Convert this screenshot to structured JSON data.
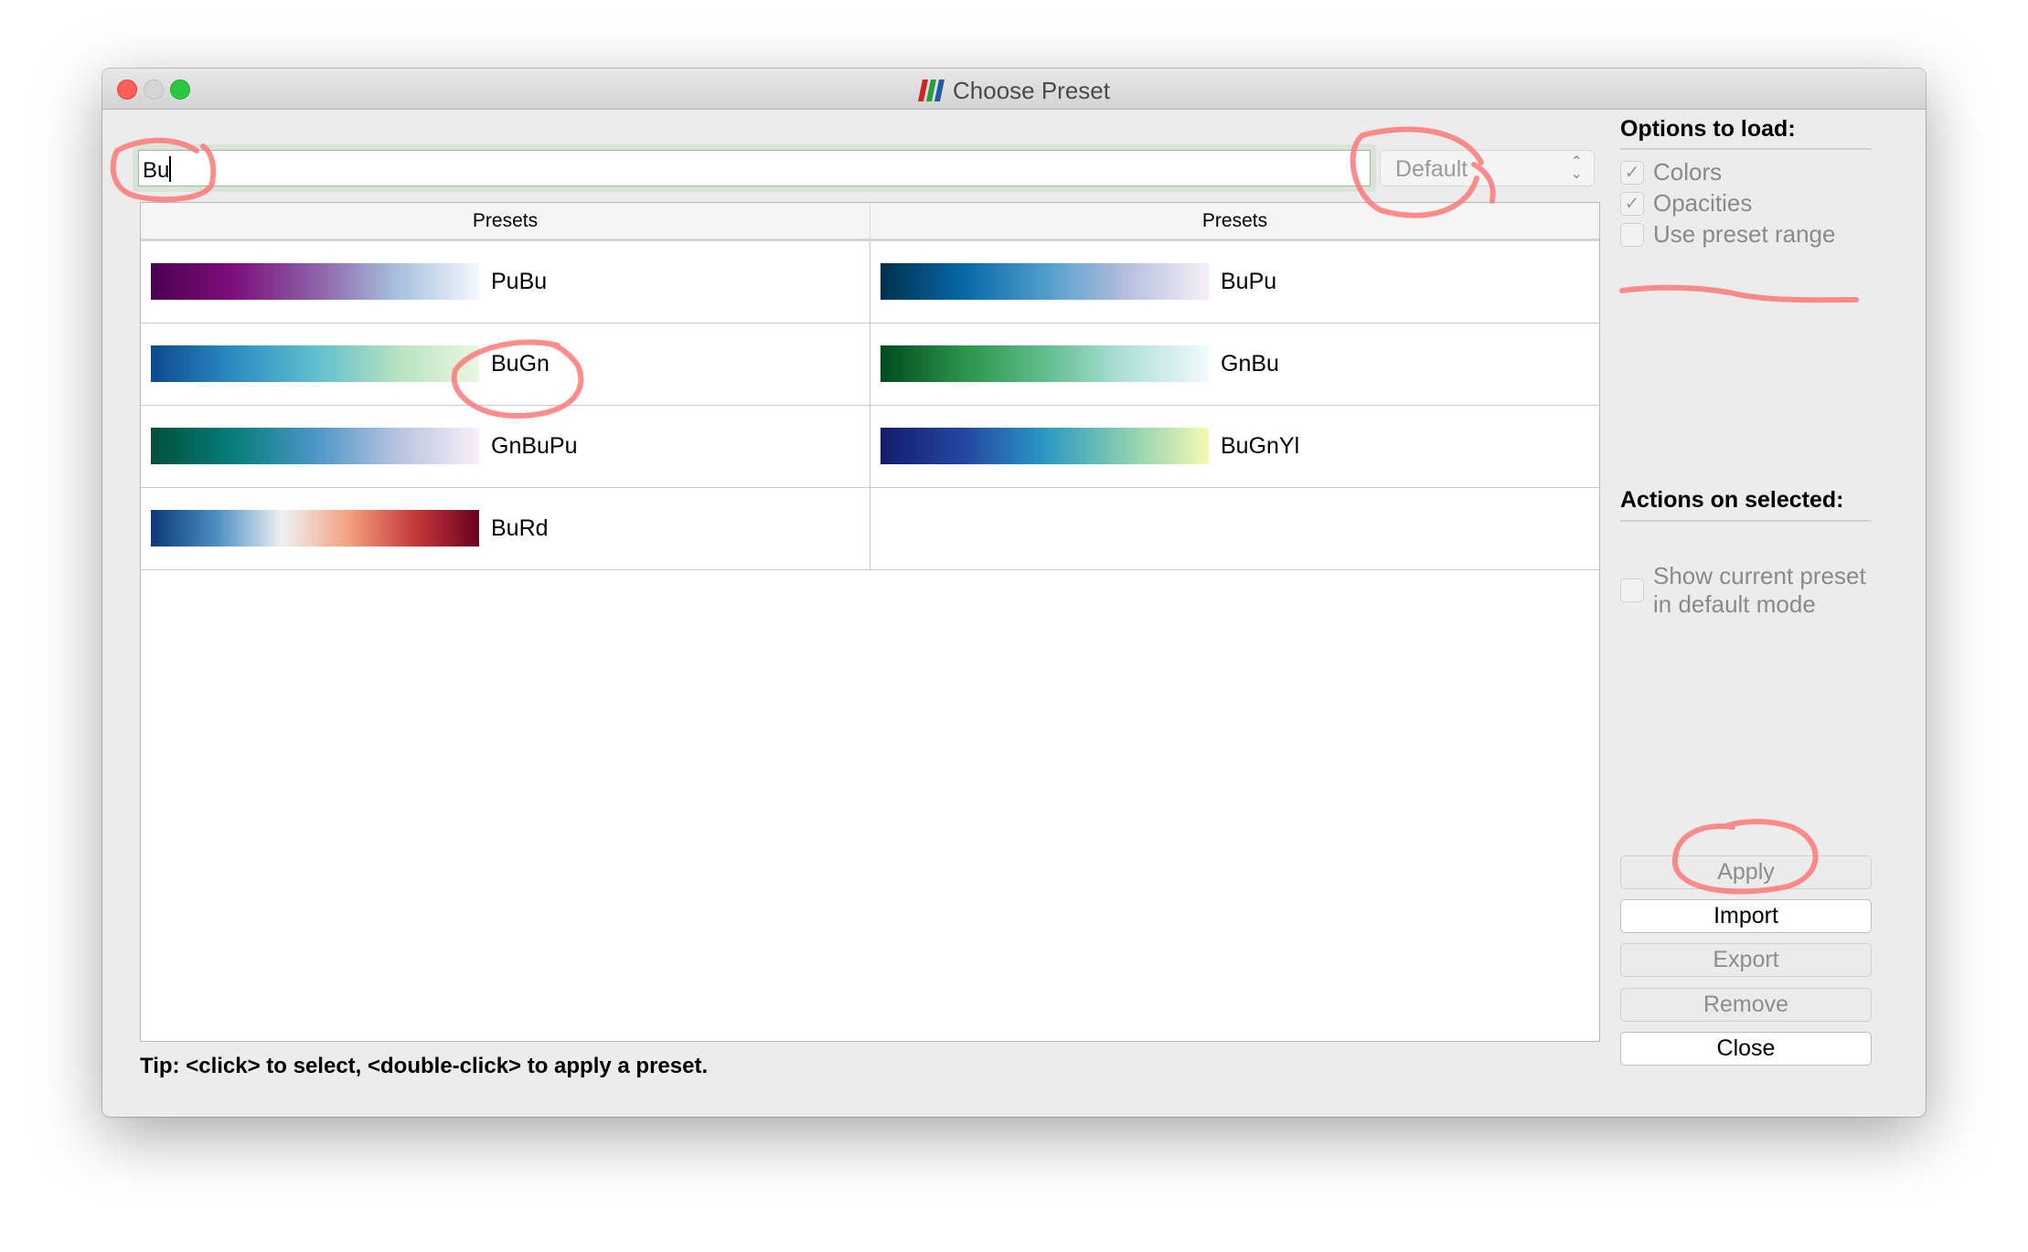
{
  "window": {
    "title": "Choose Preset",
    "logo": "paraview-logo-icon"
  },
  "search": {
    "value": "Bu"
  },
  "mode_select": {
    "value": "Default"
  },
  "table": {
    "headers": [
      "Presets",
      "Presets"
    ],
    "rows": [
      [
        {
          "name": "PuBu",
          "colors": [
            "#4a0050",
            "#7d0f7c",
            "#8c5fa6",
            "#a7c0dd",
            "#f4f8fc"
          ]
        },
        {
          "name": "BuPu",
          "colors": [
            "#01304d",
            "#0668a6",
            "#4f9dcb",
            "#b5bfdd",
            "#f6eff7"
          ]
        }
      ],
      [
        {
          "name": "BuGn",
          "colors": [
            "#0b4a8e",
            "#2b8cc3",
            "#5fbfce",
            "#b6e2bf",
            "#eaf7e2"
          ]
        },
        {
          "name": "GnBu",
          "colors": [
            "#024a1f",
            "#2a9349",
            "#5fbd8d",
            "#b2e1dc",
            "#f1fafc"
          ]
        }
      ],
      [
        {
          "name": "GnBuPu",
          "colors": [
            "#004f3b",
            "#067e7a",
            "#4b96c8",
            "#b7c3e0",
            "#f8eff8"
          ]
        },
        {
          "name": "BuGnYl",
          "colors": [
            "#141c6c",
            "#2346a0",
            "#2a98c3",
            "#88cfb0",
            "#f6fab3"
          ]
        }
      ],
      [
        {
          "name": "BuRd",
          "colors": [
            "#0a3977",
            "#4c8ec2",
            "#eef2f3",
            "#f3a27f",
            "#c73b3b",
            "#690020"
          ]
        },
        null
      ]
    ]
  },
  "options": {
    "heading": "Options to load:",
    "colors": {
      "label": "Colors",
      "checked": true
    },
    "opacities": {
      "label": "Opacities",
      "checked": true
    },
    "use_range": {
      "label": "Use preset range",
      "checked": false
    }
  },
  "actions": {
    "heading": "Actions on selected:",
    "show_current": {
      "label1": "Show current preset",
      "label2": "in default mode",
      "checked": false
    }
  },
  "buttons": {
    "apply": "Apply",
    "import": "Import",
    "export": "Export",
    "remove": "Remove",
    "close": "Close"
  },
  "tip": "Tip: <click> to select, <double-click> to apply a preset.",
  "annotation_color": "#ff7a7a"
}
